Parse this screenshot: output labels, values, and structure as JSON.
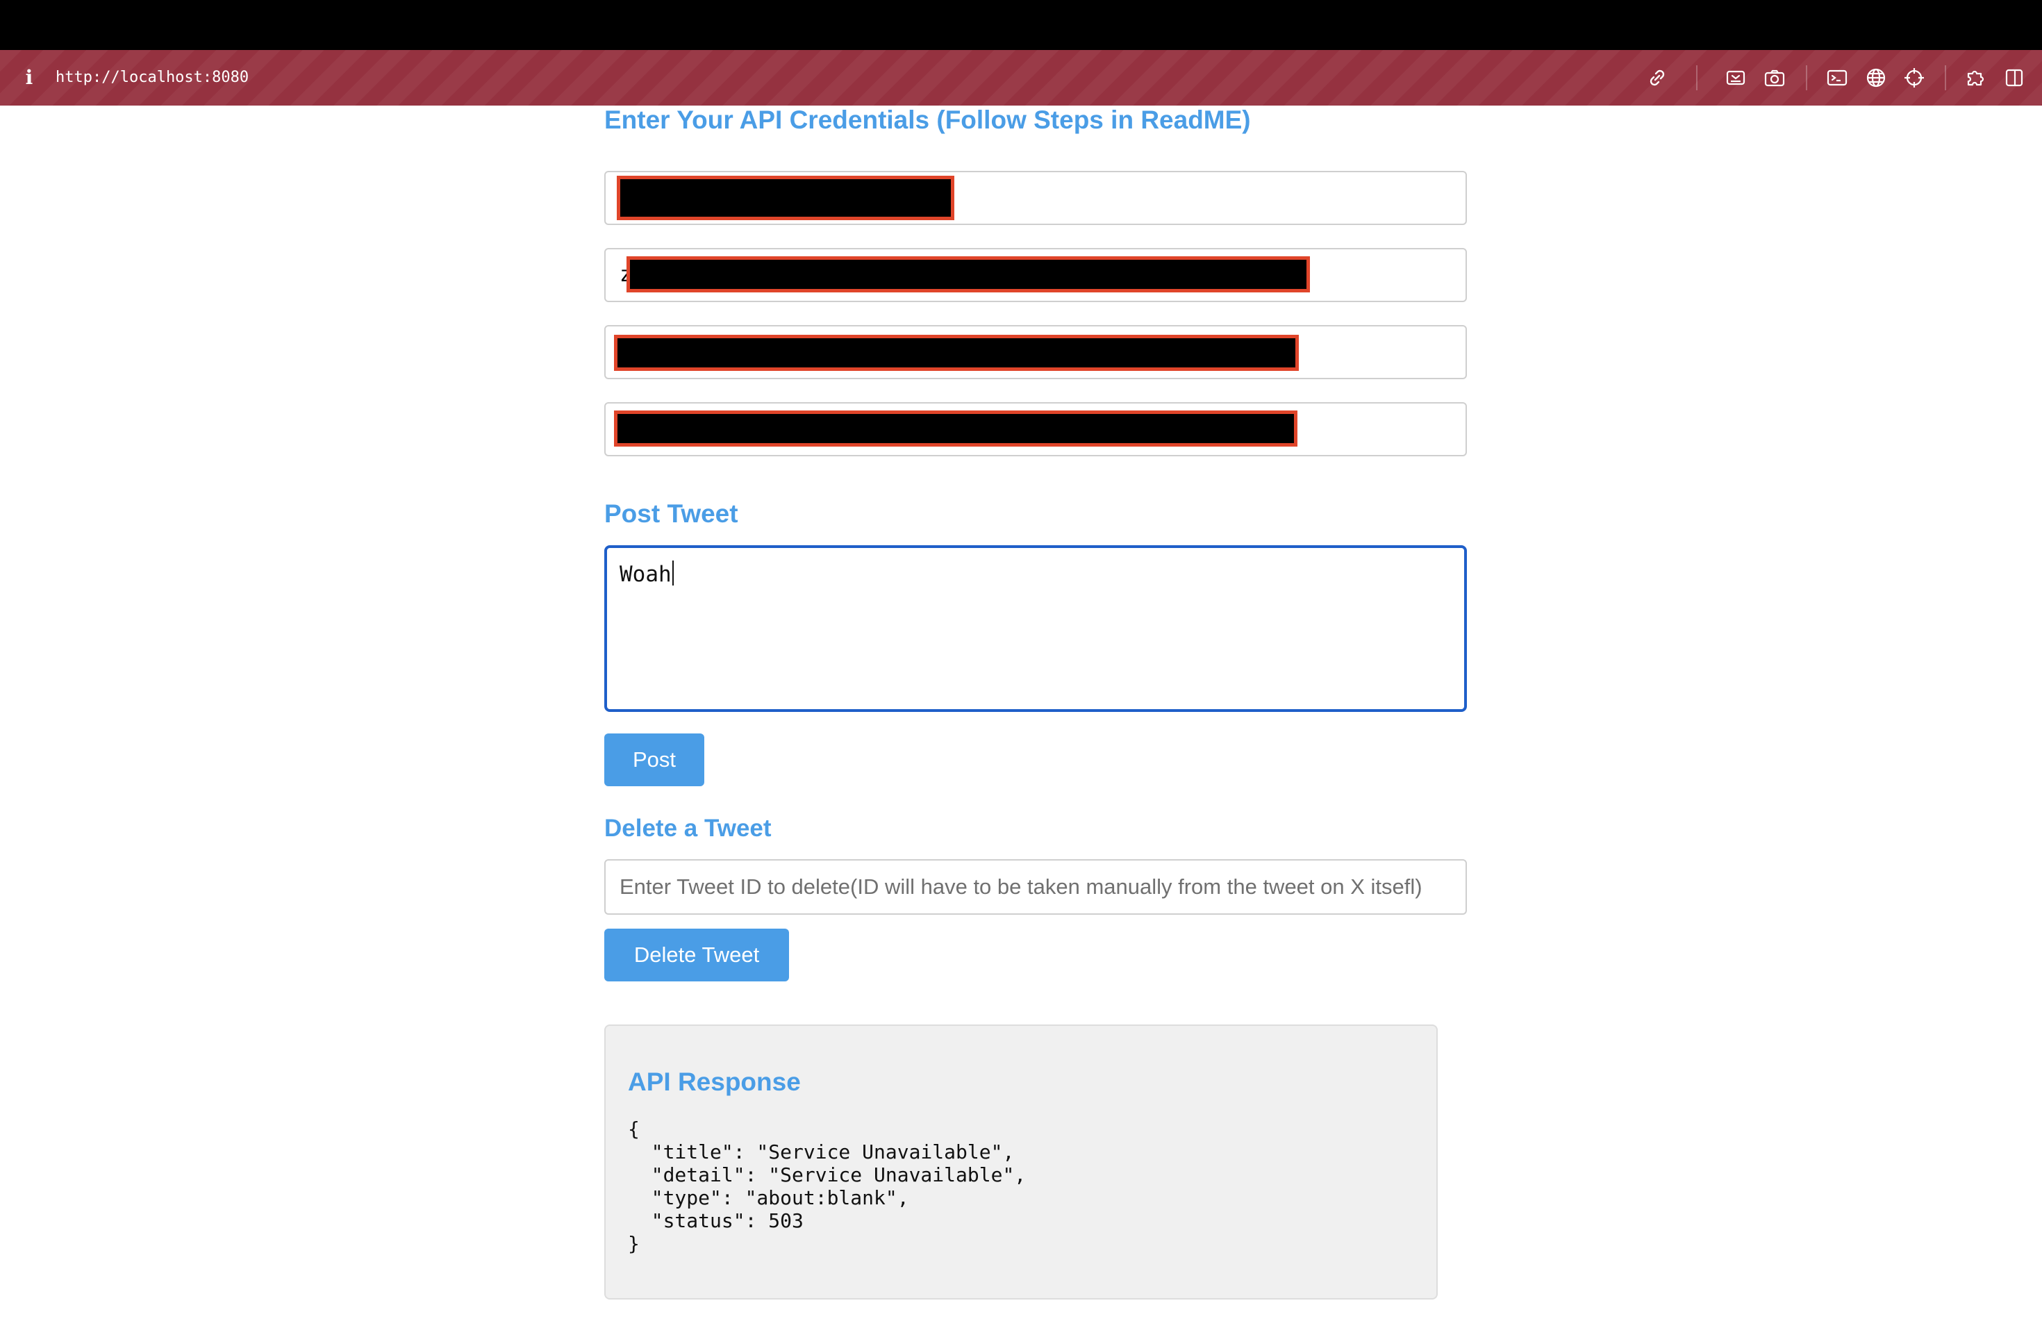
{
  "browser": {
    "url": "http://localhost:8080",
    "icons": [
      "info-icon",
      "link-icon",
      "inspect-icon",
      "camera-icon",
      "terminal-icon",
      "globe-icon",
      "crosshair-icon",
      "extensions-icon",
      "split-view-icon"
    ]
  },
  "credentials": {
    "heading": "Enter Your API Credentials (Follow Steps in ReadME)",
    "fields": [
      {
        "visible_prefix": "",
        "redacted": true
      },
      {
        "visible_prefix": "z",
        "redacted": true
      },
      {
        "visible_prefix": "",
        "redacted": true
      },
      {
        "visible_prefix": "",
        "redacted": true
      }
    ]
  },
  "post": {
    "heading": "Post Tweet",
    "tweet_text": "Woah",
    "button_label": "Post"
  },
  "delete": {
    "heading": "Delete a Tweet",
    "input_placeholder": "Enter Tweet ID to delete(ID will have to be taken manually from the tweet on X itsefl)",
    "input_value": "",
    "button_label": "Delete Tweet"
  },
  "response": {
    "heading": "API Response",
    "body": "{\n  \"title\": \"Service Unavailable\",\n  \"detail\": \"Service Unavailable\",\n  \"type\": \"about:blank\",\n  \"status\": 503\n}"
  },
  "colors": {
    "accent": "#4a9de6",
    "browser_bar": "#953240",
    "focus_border": "#1f5fc9",
    "redaction_border": "#e0452a"
  }
}
